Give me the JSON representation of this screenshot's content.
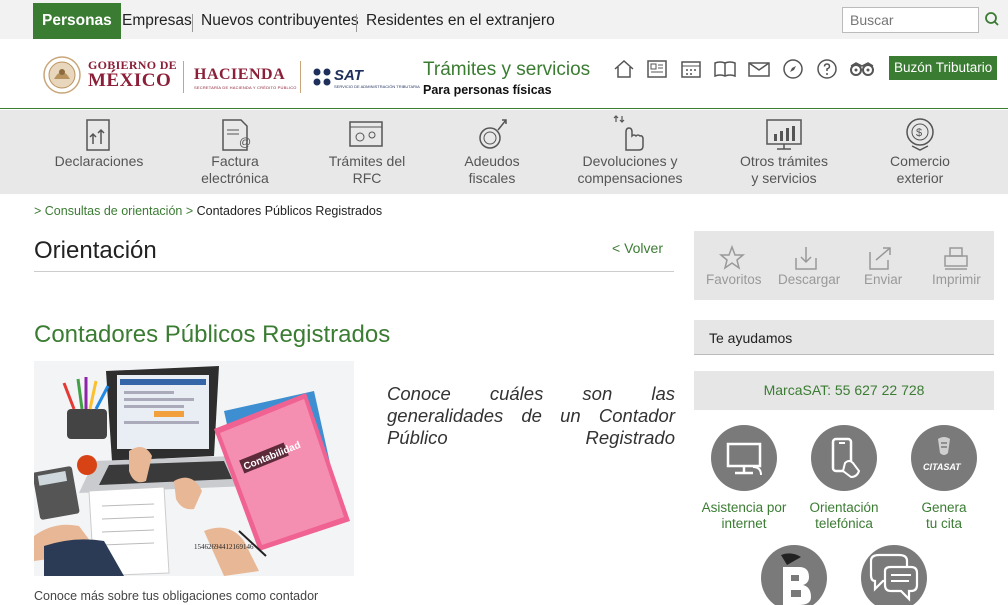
{
  "topbar": {
    "tabs": [
      {
        "label": "Personas",
        "active": true
      },
      {
        "label": "Empresas",
        "active": false
      },
      {
        "label": "Nuevos contribuyentes",
        "active": false
      },
      {
        "label": "Residentes en el extranjero",
        "active": false
      }
    ],
    "search_placeholder": "Buscar"
  },
  "header": {
    "gob_line1": "GOBIERNO DE",
    "gob_line2": "MÉXICO",
    "hacienda": "HACIENDA",
    "hacienda_sub": "SECRETARÍA DE HACIENDA Y CRÉDITO PÚBLICO",
    "sat": "SAT",
    "sat_sub": "SERVICIO DE ADMINISTRACIÓN TRIBUTARIA",
    "tramites_title": "Trámites y servicios",
    "tramites_sub": "Para personas físicas",
    "icons": [
      "home-icon",
      "news-icon",
      "calendar-icon",
      "book-icon",
      "mail-icon",
      "compass-icon",
      "help-icon",
      "binoculars-icon"
    ],
    "buzon_label": "Buzón Tributario"
  },
  "nav": {
    "items": [
      {
        "label": "Declaraciones",
        "icon": "declaraciones-icon"
      },
      {
        "label": "Factura\nelectrónica",
        "icon": "factura-icon"
      },
      {
        "label": "Trámites del\nRFC",
        "icon": "rfc-icon"
      },
      {
        "label": "Adeudos\nfiscales",
        "icon": "adeudos-icon"
      },
      {
        "label": "Devoluciones y\ncompensaciones",
        "icon": "devoluciones-icon"
      },
      {
        "label": "Otros trámites\ny servicios",
        "icon": "otros-tramites-icon"
      },
      {
        "label": "Comercio\nexterior",
        "icon": "comercio-icon"
      }
    ]
  },
  "breadcrumb": {
    "link": "> Consultas de orientación",
    "sep": " > ",
    "current": "Contadores Públicos Registrados"
  },
  "page": {
    "title": "Orientación",
    "volver": "< Volver",
    "content_title": "Contadores Públicos Registrados",
    "quote": "Conoce cuáles son las generalidades de un Contador Público Registrado",
    "caption": "Conoce más sobre tus obligaciones como contador",
    "hero": {
      "folder_label": "Contabilidad",
      "number": "15462694412169146"
    }
  },
  "tools": [
    {
      "label": "Favoritos",
      "icon": "star-icon"
    },
    {
      "label": "Descargar",
      "icon": "download-icon"
    },
    {
      "label": "Enviar",
      "icon": "send-icon"
    },
    {
      "label": "Imprimir",
      "icon": "print-icon"
    }
  ],
  "help": {
    "heading": "Te ayudamos",
    "marca": "MarcaSAT: 55 627 22 728",
    "items": [
      {
        "label": "Asistencia por\ninternet",
        "icon": "computer-icon"
      },
      {
        "label": "Orientación\ntelefónica",
        "icon": "phone-icon"
      },
      {
        "label": "Genera\ntu cita",
        "icon": "citasat-icon"
      }
    ],
    "citasat_text": "CITASAT"
  },
  "colors": {
    "green": "#3b7c33",
    "maroon": "#8b1f38",
    "nav_bg": "#e8e8e8",
    "topbar_bg": "#f2f2f2"
  }
}
